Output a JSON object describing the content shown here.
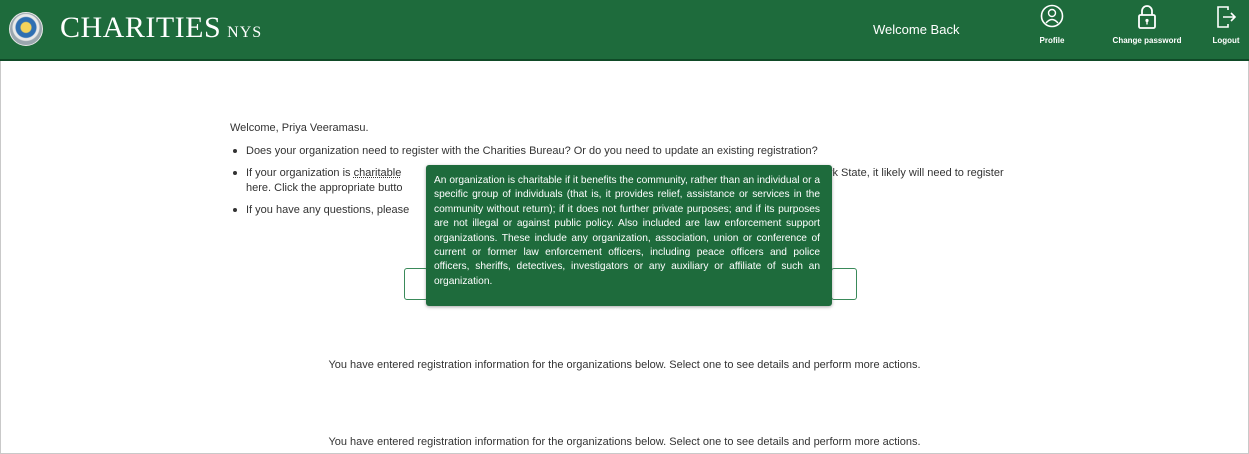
{
  "header": {
    "brand": "CHARITIES",
    "brand_suffix": "NYS",
    "welcome": "Welcome Back",
    "nav": [
      {
        "label": "Profile",
        "icon": "profile-icon"
      },
      {
        "label": "Change password",
        "icon": "lock-icon"
      },
      {
        "label": "Logout",
        "icon": "logout-icon"
      }
    ],
    "colors": {
      "bar": "#1e6b3c",
      "text": "#ffffff"
    }
  },
  "main": {
    "greeting": "Welcome, Priya Veeramasu.",
    "bullets": {
      "q1": "Does your organization need to register with the Charities Bureau? Or do you need to update an existing registration?",
      "q2_prefix": "If your organization is ",
      "q2_link": "charitable",
      "q2_tail": "y York State, it likely will need to register",
      "q2_line2": "here. Click the appropriate butto",
      "q3": "If you have any questions, please"
    },
    "tooltip": "An organization is charitable if it benefits the community, rather than an individual or a specific group of individuals (that is, it provides relief, assistance or services in the community without return); if it does not further private purposes; and if its purposes are not illegal or against public policy. Also included are law enforcement support organizations. These include any organization, association, union or conference of current or former law enforcement officers, including peace officers and police officers, sheriffs, detectives, investigators or any auxiliary or affiliate of such an organization.",
    "info_1": "You have entered registration information for the organizations below. Select one to see details and perform more actions.",
    "info_2": "You have entered registration information for the organizations below. Select one to see details and perform more actions."
  }
}
